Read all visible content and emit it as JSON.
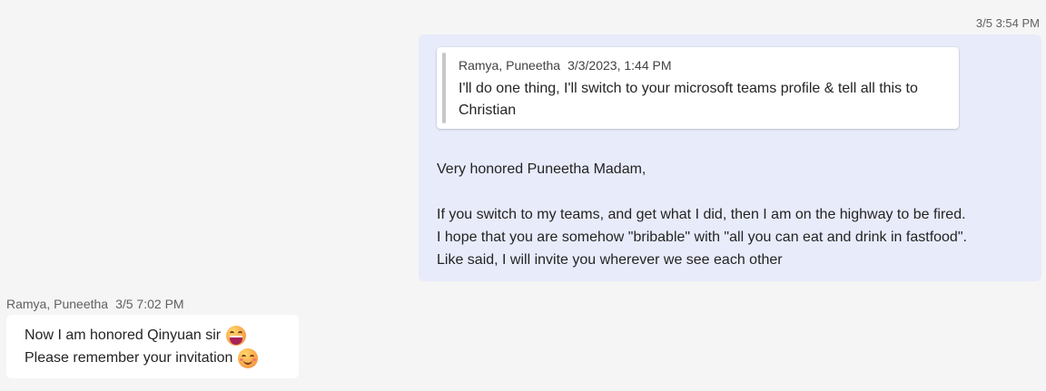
{
  "outgoing": {
    "timestamp": "3/5 3:54 PM",
    "quote": {
      "author": "Ramya, Puneetha",
      "timestamp": "3/3/2023, 1:44 PM",
      "text": "I'll do one thing, I'll switch to your microsoft teams profile & tell all this to Christian"
    },
    "body": {
      "greeting": "Very honored Puneetha Madam,",
      "line1": "If you switch to my teams, and get what I did, then I am on the highway to be fired.",
      "line2": "I hope that you are somehow \"bribable\" with \"all you can eat and drink in fastfood\".",
      "line3": "Like said, I will invite you wherever we see each other"
    },
    "bubble_color": "#e8ebfa"
  },
  "incoming": {
    "author": "Ramya, Puneetha",
    "timestamp": "3/5 7:02 PM",
    "line1": "Now I am honored Qinyuan sir",
    "line1_emoji": "grinning-face-emoji",
    "line2": "Please remember your invitation",
    "line2_emoji": "smiling-face-emoji",
    "bubble_color": "#ffffff"
  },
  "colors": {
    "background": "#f5f5f5",
    "text": "#242424",
    "meta_text": "#616161"
  }
}
